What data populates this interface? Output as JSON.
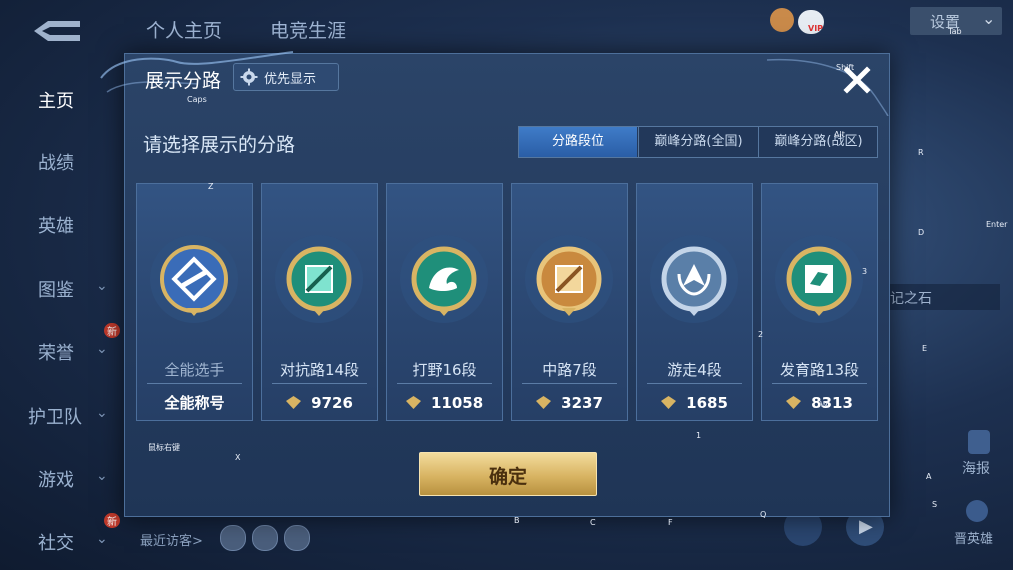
{
  "header": {
    "tabs": [
      "个人主页",
      "电竞生涯"
    ],
    "right_button_label": "设置",
    "vip_label": "VIP",
    "tab_key_hint": "Tab",
    "shift_key_hint": "Shift"
  },
  "sidebar": {
    "items": [
      {
        "label": "主页",
        "active": true,
        "chevron": false,
        "new": false
      },
      {
        "label": "战绩",
        "active": false,
        "chevron": false,
        "new": false
      },
      {
        "label": "英雄",
        "active": false,
        "chevron": false,
        "new": false
      },
      {
        "label": "图鉴",
        "active": false,
        "chevron": true,
        "new": false
      },
      {
        "label": "荣誉",
        "active": false,
        "chevron": true,
        "new": true
      },
      {
        "label": "护卫队",
        "active": false,
        "chevron": true,
        "new": false
      },
      {
        "label": "游戏",
        "active": false,
        "chevron": true,
        "new": false
      },
      {
        "label": "社交",
        "active": false,
        "chevron": true,
        "new": true
      }
    ],
    "new_badge": "新"
  },
  "right_panel": {
    "stone_label": "记之石",
    "poster_label": "海报",
    "promote_label": "晋英雄"
  },
  "footer": {
    "recent_visitors": "最近访客>"
  },
  "key_hints": {
    "caps": "Caps",
    "alt": "Alt",
    "enter": "Enter",
    "z": "Z",
    "x": "X",
    "r": "R",
    "d": "D",
    "e": "E",
    "a": "A",
    "s": "S",
    "b": "B",
    "c": "C",
    "f": "F",
    "q": "Q",
    "n1": "1",
    "n2": "2",
    "n3": "3",
    "mouse_lock": "鼠标右键",
    "w": "W"
  },
  "modal": {
    "title": "展示分路",
    "priority_button": "优先显示",
    "subtitle": "请选择展示的分路",
    "tabs": [
      "分路段位",
      "巅峰分路(全国)",
      "巅峰分路(战区)"
    ],
    "active_tab": 0,
    "cards": [
      {
        "label": "全能选手",
        "value": "全能称号",
        "type": "all",
        "icon": "all-round-badge-icon",
        "dim": true
      },
      {
        "label": "对抗路14段",
        "value": "9726",
        "type": "points",
        "icon": "clash-lane-badge-icon",
        "dim": false
      },
      {
        "label": "打野16段",
        "value": "11058",
        "type": "points",
        "icon": "jungle-badge-icon",
        "dim": false
      },
      {
        "label": "中路7段",
        "value": "3237",
        "type": "points",
        "icon": "mid-lane-badge-icon",
        "dim": false
      },
      {
        "label": "游走4段",
        "value": "1685",
        "type": "points",
        "icon": "roam-badge-icon",
        "dim": false
      },
      {
        "label": "发育路13段",
        "value": "8313",
        "type": "points",
        "icon": "farm-lane-badge-icon",
        "dim": false
      }
    ],
    "confirm_label": "确定"
  },
  "colors": {
    "accent_blue": "#3f7cc8",
    "gold": "#d8b463",
    "modal_bg": "#2b4468"
  }
}
